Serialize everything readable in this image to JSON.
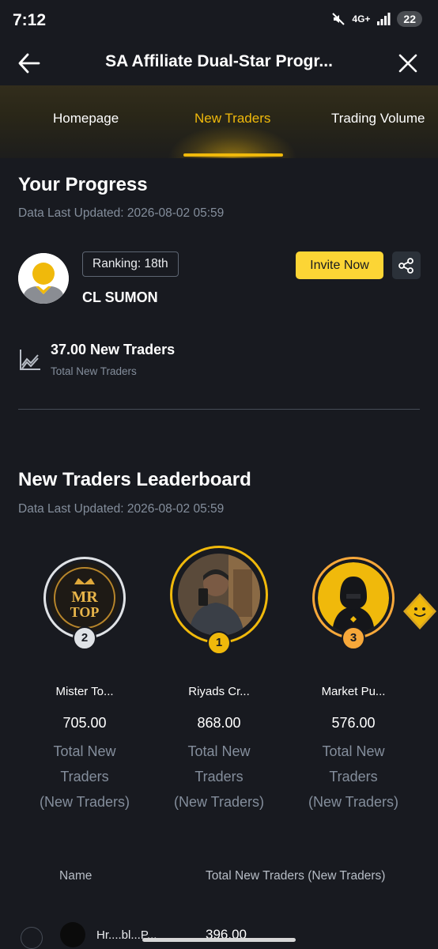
{
  "status_bar": {
    "time": "7:12",
    "network": "4G+",
    "battery": "22"
  },
  "header": {
    "title": "SA Affiliate Dual-Star Progr..."
  },
  "tabs": [
    {
      "label": "Homepage",
      "active": false
    },
    {
      "label": "New Traders",
      "active": true
    },
    {
      "label": "Trading Volume",
      "active": false
    }
  ],
  "progress": {
    "title": "Your Progress",
    "updated": "Data Last Updated: 2026-08-02 05:59",
    "ranking": "Ranking: 18th",
    "username": "CL SUMON",
    "invite_label": "Invite Now",
    "stat_value": "37.00 New Traders",
    "stat_label": "Total New Traders"
  },
  "leaderboard": {
    "title": "New Traders Leaderboard",
    "updated": "Data Last Updated: 2026-08-02 05:59",
    "podium": [
      {
        "rank": "2",
        "name": "Mister To...",
        "score": "705.00",
        "label_lines": [
          "Total New",
          "Traders",
          "(New Traders)"
        ]
      },
      {
        "rank": "1",
        "name": "Riyads Cr...",
        "score": "868.00",
        "label_lines": [
          "Total New",
          "Traders",
          "(New Traders)"
        ]
      },
      {
        "rank": "3",
        "name": "Market Pu...",
        "score": "576.00",
        "label_lines": [
          "Total New",
          "Traders",
          "(New Traders)"
        ]
      }
    ],
    "columns": {
      "name": "Name",
      "total": "Total New Traders (New Traders)"
    },
    "partial_row": {
      "name": "Hr....bl...P...",
      "value": "396.00"
    }
  },
  "colors": {
    "accent": "#f0b90b",
    "background": "#181a20",
    "muted": "#848e9c"
  }
}
